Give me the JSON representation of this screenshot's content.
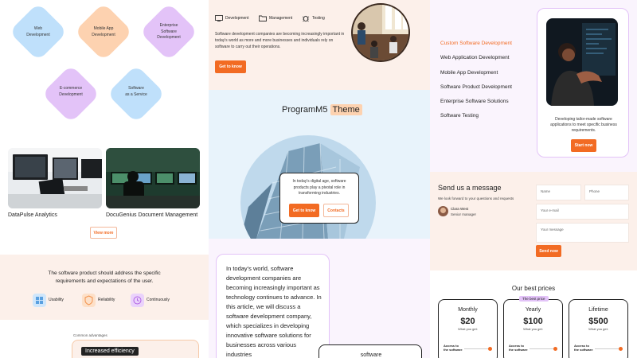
{
  "services_diagram": {
    "heading_partial": "...",
    "items": [
      {
        "label": "Web\nDevelopment",
        "color": "#bfe0fb"
      },
      {
        "label": "Mobile App\nDevelopment",
        "color": "#fdd2b0"
      },
      {
        "label": "Enterprise\nSoftware\nDevelopment",
        "color": "#e3c3f8"
      },
      {
        "label": "E-commerce\nDevelopment",
        "color": "#e3c3f8"
      },
      {
        "label": "Software\nas a Service",
        "color": "#bfe0fb"
      }
    ]
  },
  "projects": {
    "items": [
      {
        "title": "DataPulse Analytics"
      },
      {
        "title": "DocuGenius Document Management"
      }
    ],
    "view_more": "View more"
  },
  "requirements": {
    "text": "The software product should address the specific requirements and expectations of the user.",
    "features": [
      {
        "label": "Usability",
        "icon": "usability-icon",
        "color": "#cfe6fb"
      },
      {
        "label": "Reliability",
        "icon": "shield-icon",
        "color": "#fde0c8"
      },
      {
        "label": "Continuously",
        "icon": "clock-icon",
        "color": "#ead2fb"
      }
    ]
  },
  "advantages": {
    "label": "Common advantages",
    "badge": "Increased efficiency"
  },
  "intro": {
    "tabs": [
      {
        "label": "Development",
        "icon": "monitor-icon"
      },
      {
        "label": "Management",
        "icon": "folder-icon"
      },
      {
        "label": "Testing",
        "icon": "bug-icon"
      }
    ],
    "body": "Software development companies are becoming increasingly important in today's world as more and more businesses and individuals rely on software to carry out their operations.",
    "cta": "Get to know"
  },
  "hero": {
    "title_plain": "ProgramM5",
    "title_highlight": "Theme",
    "card_text": "In today's digital age, software products play a pivotal role in transforming industries.",
    "primary_btn": "Get to know",
    "secondary_btn": "Contacts"
  },
  "article": {
    "body": "In today's world, software development companies are becoming increasingly important as technology continues to advance. In this article, we will discuss a software development company, which specializes in developing innovative software solutions for businesses across various industries",
    "chip": "software"
  },
  "service_menu": {
    "items": [
      {
        "label": "Custom Software Development",
        "active": true
      },
      {
        "label": "Web Application Development",
        "active": false
      },
      {
        "label": "Mobile App Development",
        "active": false
      },
      {
        "label": "Software Product Development",
        "active": false
      },
      {
        "label": "Enterprise Software Solutions",
        "active": false
      },
      {
        "label": "Software Testing",
        "active": false
      }
    ],
    "card_text": "Developing tailor-made software applications to meet specific business requirements.",
    "card_btn": "Start now"
  },
  "contact": {
    "title": "Send us a message",
    "subtitle": "We look forward to your questions and requests",
    "person_name": "Clara West",
    "person_role": "Senior manager",
    "placeholders": {
      "name": "Name",
      "phone": "Phone",
      "email": "Your e-mail",
      "message": "Your message"
    },
    "send": "Send now"
  },
  "pricing": {
    "title": "Our best prices",
    "badge": "The best price",
    "plans": [
      {
        "name": "Monthly",
        "price": "$20",
        "get": "What you get:",
        "access": "Access to the software"
      },
      {
        "name": "Yearly",
        "price": "$100",
        "get": "What you get:",
        "access": "Access to the software"
      },
      {
        "name": "Lifetime",
        "price": "$500",
        "get": "What you get:",
        "access": "Access to the software"
      }
    ]
  },
  "colors": {
    "accent": "#f26b23",
    "peach_bg": "#fcf0ea",
    "lavender_bg": "#faf4fd",
    "blue_bg": "#e8f3fb"
  }
}
